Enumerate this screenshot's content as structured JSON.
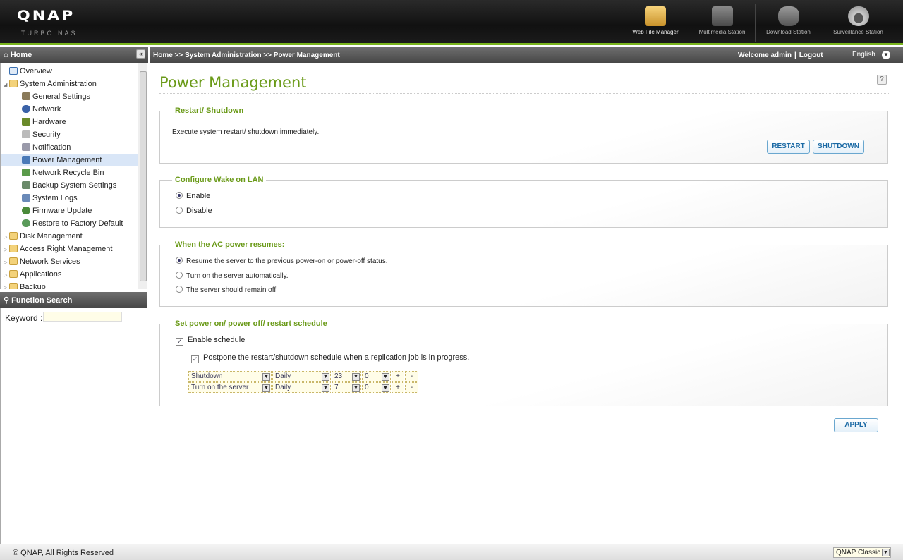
{
  "header": {
    "logo": "QNAP",
    "logo_sub": "TURBO NAS",
    "stations": [
      {
        "label": "Web File Manager",
        "icon": "web-file-manager-icon"
      },
      {
        "label": "Multimedia Station",
        "icon": "multimedia-station-icon"
      },
      {
        "label": "Download Station",
        "icon": "download-station-icon"
      },
      {
        "label": "Surveillance Station",
        "icon": "surveillance-station-icon"
      }
    ]
  },
  "nav": {
    "home_label": "Home",
    "collapse": "«",
    "breadcrumb": "Home >> System Administration >> Power Management",
    "welcome": "Welcome admin",
    "logout": "Logout",
    "language": "English"
  },
  "tree": {
    "items": [
      {
        "label": "Overview"
      },
      {
        "label": "System Administration"
      },
      {
        "label": "General Settings"
      },
      {
        "label": "Network"
      },
      {
        "label": "Hardware"
      },
      {
        "label": "Security"
      },
      {
        "label": "Notification"
      },
      {
        "label": "Power Management"
      },
      {
        "label": "Network Recycle Bin"
      },
      {
        "label": "Backup System Settings"
      },
      {
        "label": "System Logs"
      },
      {
        "label": "Firmware Update"
      },
      {
        "label": "Restore to Factory Default"
      },
      {
        "label": "Disk Management"
      },
      {
        "label": "Access Right Management"
      },
      {
        "label": "Network Services"
      },
      {
        "label": "Applications"
      },
      {
        "label": "Backup"
      }
    ]
  },
  "function_search": {
    "title": "Function Search",
    "keyword_label": "Keyword :",
    "keyword_value": ""
  },
  "main": {
    "title": "Power Management",
    "help": "?",
    "restart_section": {
      "title": "Restart/ Shutdown",
      "description": "Execute system restart/ shutdown immediately.",
      "restart_label": "RESTART",
      "shutdown_label": "SHUTDOWN"
    },
    "wol_section": {
      "title": "Configure Wake on LAN",
      "enable": "Enable",
      "disable": "Disable",
      "selected": "Enable"
    },
    "ac_section": {
      "title": "When the AC power resumes:",
      "options": [
        "Resume the server to the previous power-on or power-off status.",
        "Turn on the server automatically.",
        "The server should remain off."
      ],
      "selected_index": 0
    },
    "schedule_section": {
      "title": "Set power on/ power off/ restart schedule",
      "enable_label": "Enable schedule",
      "enable_checked": true,
      "postpone_label": "Postpone the restart/shutdown schedule when a replication job is in progress.",
      "postpone_checked": true,
      "rows": [
        {
          "action": "Shutdown",
          "frequency": "Daily",
          "hour": "23",
          "minute": "0",
          "plus": "+",
          "minus": "-"
        },
        {
          "action": "Turn on the server",
          "frequency": "Daily",
          "hour": "7",
          "minute": "0",
          "plus": "+",
          "minus": "-"
        }
      ]
    },
    "apply_label": "APPLY"
  },
  "footer": {
    "copyright": "© QNAP, All Rights Reserved",
    "theme": "QNAP Classic"
  },
  "colors": {
    "accent_green": "#7ab51d",
    "title_green": "#6a9a18",
    "button_blue": "#1b6aa5"
  }
}
